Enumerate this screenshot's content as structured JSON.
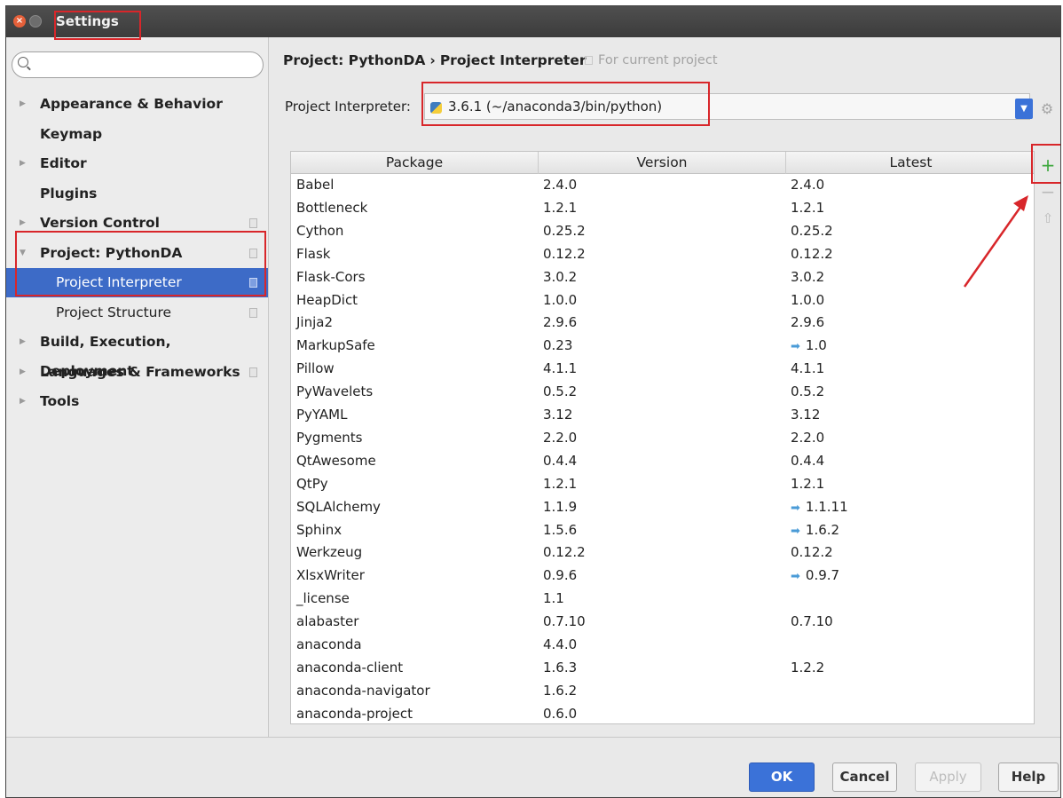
{
  "window": {
    "title": "Settings"
  },
  "search": {
    "placeholder": ""
  },
  "sidebar": {
    "items": [
      {
        "label": "Appearance & Behavior",
        "arrow": true,
        "icon": false,
        "sub": false
      },
      {
        "label": "Keymap",
        "arrow": false,
        "icon": false,
        "sub": false
      },
      {
        "label": "Editor",
        "arrow": true,
        "icon": false,
        "sub": false
      },
      {
        "label": "Plugins",
        "arrow": false,
        "icon": false,
        "sub": false
      },
      {
        "label": "Version Control",
        "arrow": true,
        "icon": true,
        "sub": false
      },
      {
        "label": "Project: PythonDA",
        "arrow": true,
        "icon": true,
        "sub": false
      },
      {
        "label": "Project Interpreter",
        "arrow": false,
        "icon": true,
        "sub": true,
        "selected": true
      },
      {
        "label": "Project Structure",
        "arrow": false,
        "icon": true,
        "sub": true
      },
      {
        "label": "Build, Execution, Deployment",
        "arrow": true,
        "icon": false,
        "sub": false
      },
      {
        "label": "Languages & Frameworks",
        "arrow": true,
        "icon": true,
        "sub": false
      },
      {
        "label": "Tools",
        "arrow": true,
        "icon": false,
        "sub": false
      }
    ]
  },
  "breadcrumb": {
    "project": "Project: PythonDA",
    "separator": "›",
    "page": "Project Interpreter",
    "note": "For current project"
  },
  "interpreter": {
    "label": "Project Interpreter:",
    "value": "3.6.1 (~/anaconda3/bin/python)"
  },
  "table": {
    "headers": [
      "Package",
      "Version",
      "Latest"
    ],
    "rows": [
      {
        "package": "Babel",
        "version": "2.4.0",
        "latest": "2.4.0",
        "update": false
      },
      {
        "package": "Bottleneck",
        "version": "1.2.1",
        "latest": "1.2.1",
        "update": false
      },
      {
        "package": "Cython",
        "version": "0.25.2",
        "latest": "0.25.2",
        "update": false
      },
      {
        "package": "Flask",
        "version": "0.12.2",
        "latest": "0.12.2",
        "update": false
      },
      {
        "package": "Flask-Cors",
        "version": "3.0.2",
        "latest": "3.0.2",
        "update": false
      },
      {
        "package": "HeapDict",
        "version": "1.0.0",
        "latest": "1.0.0",
        "update": false
      },
      {
        "package": "Jinja2",
        "version": "2.9.6",
        "latest": "2.9.6",
        "update": false
      },
      {
        "package": "MarkupSafe",
        "version": "0.23",
        "latest": "1.0",
        "update": true
      },
      {
        "package": "Pillow",
        "version": "4.1.1",
        "latest": "4.1.1",
        "update": false
      },
      {
        "package": "PyWavelets",
        "version": "0.5.2",
        "latest": "0.5.2",
        "update": false
      },
      {
        "package": "PyYAML",
        "version": "3.12",
        "latest": "3.12",
        "update": false
      },
      {
        "package": "Pygments",
        "version": "2.2.0",
        "latest": "2.2.0",
        "update": false
      },
      {
        "package": "QtAwesome",
        "version": "0.4.4",
        "latest": "0.4.4",
        "update": false
      },
      {
        "package": "QtPy",
        "version": "1.2.1",
        "latest": "1.2.1",
        "update": false
      },
      {
        "package": "SQLAlchemy",
        "version": "1.1.9",
        "latest": "1.1.11",
        "update": true
      },
      {
        "package": "Sphinx",
        "version": "1.5.6",
        "latest": "1.6.2",
        "update": true
      },
      {
        "package": "Werkzeug",
        "version": "0.12.2",
        "latest": "0.12.2",
        "update": false
      },
      {
        "package": "XlsxWriter",
        "version": "0.9.6",
        "latest": "0.9.7",
        "update": true
      },
      {
        "package": "_license",
        "version": "1.1",
        "latest": "",
        "update": false
      },
      {
        "package": "alabaster",
        "version": "0.7.10",
        "latest": "0.7.10",
        "update": false
      },
      {
        "package": "anaconda",
        "version": "4.4.0",
        "latest": "",
        "update": false
      },
      {
        "package": "anaconda-client",
        "version": "1.6.3",
        "latest": "1.2.2",
        "update": false
      },
      {
        "package": "anaconda-navigator",
        "version": "1.6.2",
        "latest": "",
        "update": false
      },
      {
        "package": "anaconda-project",
        "version": "0.6.0",
        "latest": "",
        "update": false
      }
    ]
  },
  "tools": {
    "add": "+",
    "remove": "−",
    "upgrade": "⇧"
  },
  "footer": {
    "ok": "OK",
    "cancel": "Cancel",
    "apply": "Apply",
    "help": "Help"
  },
  "colors": {
    "accent": "#3b72d8",
    "selection": "#3d6bc7",
    "highlight": "#d8262a",
    "add": "#3ea83e",
    "update_arrow": "#4a9bd7"
  }
}
